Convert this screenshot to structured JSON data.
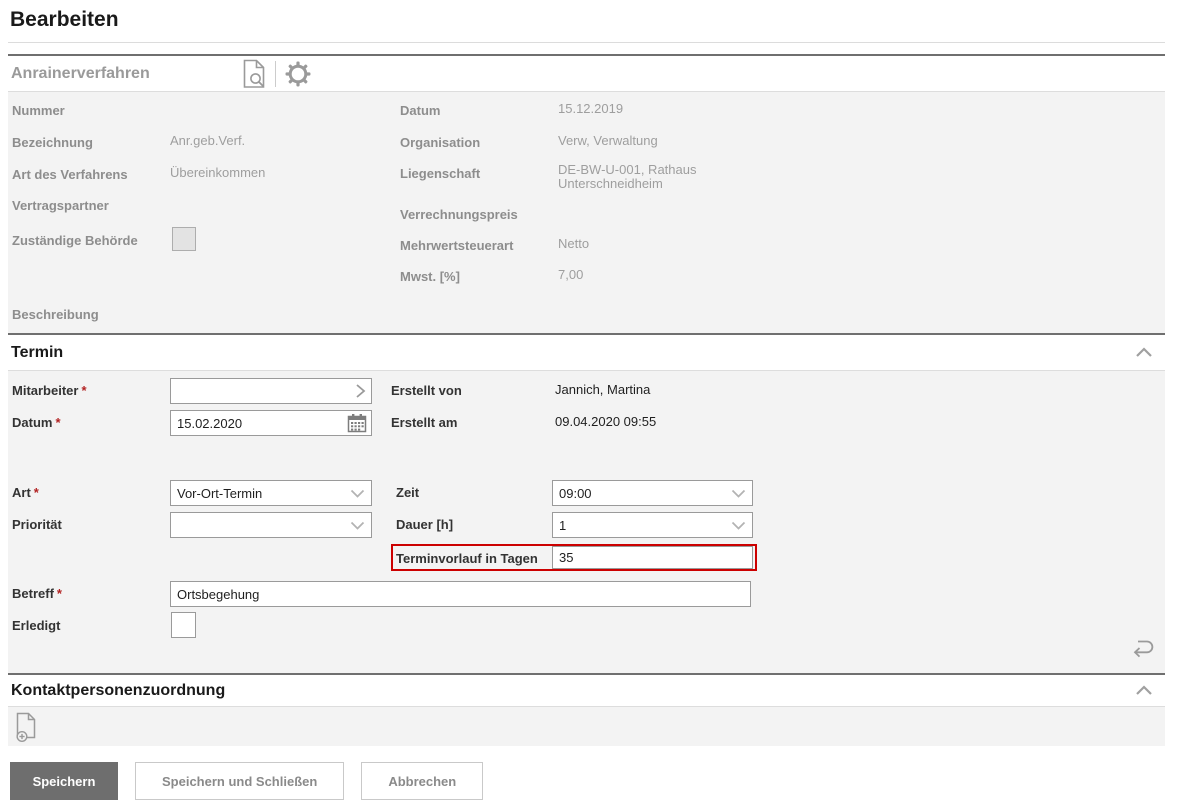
{
  "page": {
    "title": "Bearbeiten"
  },
  "procedure_section": {
    "title": "Anrainerverfahren",
    "toolbar_icons": [
      "document-preview-icon",
      "gear-icon"
    ],
    "fields": {
      "nummer_label": "Nummer",
      "bezeichnung_label": "Bezeichnung",
      "bezeichnung_value": "Anr.geb.Verf.",
      "art_label": "Art des Verfahrens",
      "art_value": "Übereinkommen",
      "vertragspartner_label": "Vertragspartner",
      "behoerde_label": "Zuständige Behörde",
      "beschreibung_label": "Beschreibung",
      "datum_label": "Datum",
      "datum_value": "15.12.2019",
      "organisation_label": "Organisation",
      "organisation_value": "Verw, Verwaltung",
      "liegenschaft_label": "Liegenschaft",
      "liegenschaft_value": "DE-BW-U-001, Rathaus Unterschneidheim",
      "verrechnungspreis_label": "Verrechnungspreis",
      "mehrwertsteuerart_label": "Mehrwertsteuerart",
      "mehrwertsteuerart_value": "Netto",
      "mwst_label": "Mwst. [%]",
      "mwst_value": "7,00"
    }
  },
  "termin_section": {
    "title": "Termin",
    "required_marker": "*",
    "fields": {
      "mitarbeiter_label": "Mitarbeiter",
      "mitarbeiter_value": "",
      "datum_label": "Datum",
      "datum_value": "15.02.2020",
      "erstellt_von_label": "Erstellt von",
      "erstellt_von_value": "Jannich, Martina",
      "erstellt_am_label": "Erstellt am",
      "erstellt_am_value": "09.04.2020 09:55",
      "art_label": "Art",
      "art_value": "Vor-Ort-Termin",
      "prioritaet_label": "Priorität",
      "prioritaet_value": "",
      "zeit_label": "Zeit",
      "zeit_value": "09:00",
      "dauer_label": "Dauer [h]",
      "dauer_value": "1",
      "terminvorlauf_label": "Terminvorlauf in Tagen",
      "terminvorlauf_value": "35",
      "betreff_label": "Betreff",
      "betreff_value": "Ortsbegehung",
      "erledigt_label": "Erledigt",
      "erledigt_checked": false
    }
  },
  "kontakt_section": {
    "title": "Kontaktpersonenzuordnung",
    "toolbar_icons": [
      "add-document-icon"
    ]
  },
  "actions": {
    "save": "Speichern",
    "save_close": "Speichern und Schließen",
    "cancel": "Abbrechen"
  },
  "colors": {
    "primary_button_bg": "#6e6e6e",
    "highlight_border": "#cc0000",
    "panel_bg": "#f3f3f3",
    "required_marker": "#b22222",
    "section_border": "#6f6f6f"
  }
}
